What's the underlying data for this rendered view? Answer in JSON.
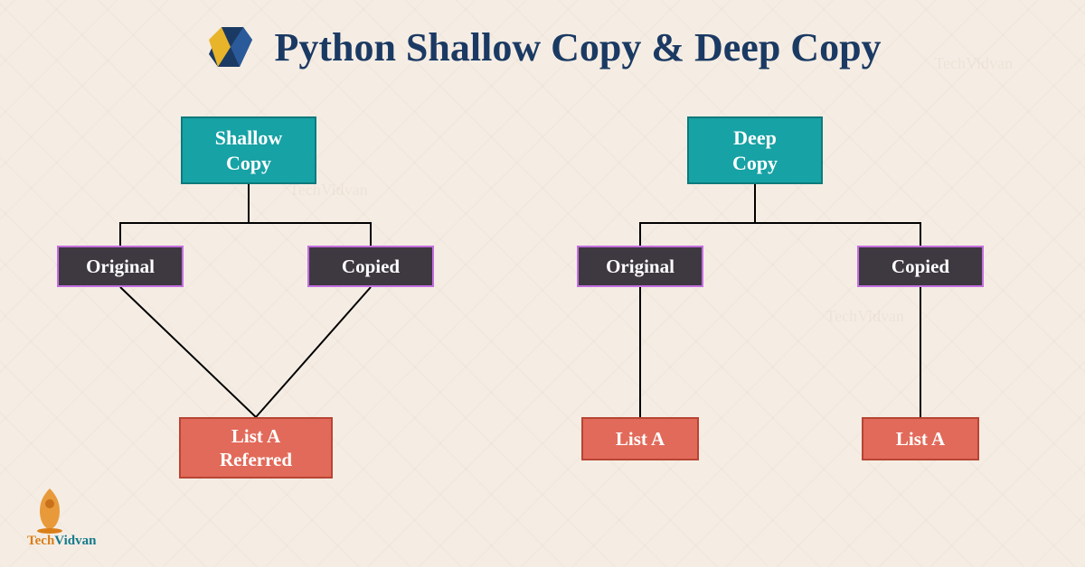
{
  "header": {
    "title": "Python Shallow Copy & Deep Copy"
  },
  "shallow": {
    "root_l1": "Shallow",
    "root_l2": "Copy",
    "original": "Original",
    "copied": "Copied",
    "leaf_l1": "List A",
    "leaf_l2": "Referred"
  },
  "deep": {
    "root_l1": "Deep",
    "root_l2": "Copy",
    "original": "Original",
    "copied": "Copied",
    "leaf1": "List A",
    "leaf2": "List A"
  },
  "brand": {
    "part1": "Tech",
    "part2": "Vidvan"
  }
}
